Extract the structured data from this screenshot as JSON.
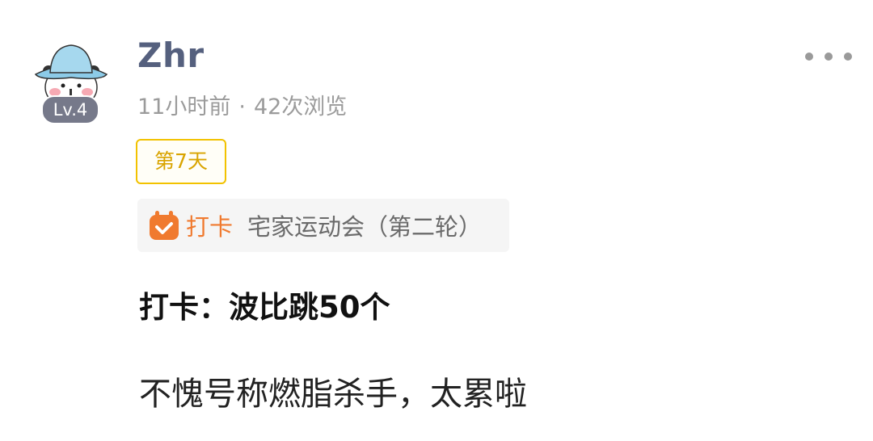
{
  "post": {
    "author": {
      "name": "Zhr",
      "level": "Lv.4"
    },
    "meta": {
      "time": "11小时前",
      "separator": "·",
      "views": "42次浏览"
    },
    "day_tag": "第7天",
    "checkin": {
      "label": "打卡",
      "activity": "宅家运动会（第二轮）"
    },
    "title": "打卡：波比跳50个",
    "body": "不愧号称燃脂杀手，太累啦"
  },
  "icons": {
    "more": "more-horizontal-icon",
    "checkin": "calendar-check-icon"
  },
  "colors": {
    "username": "#55607e",
    "meta": "#9b9b9b",
    "day_tag_border": "#f2c200",
    "day_tag_text": "#d9a400",
    "checkin_accent": "#f07a2f",
    "level_badge": "#76798a"
  }
}
